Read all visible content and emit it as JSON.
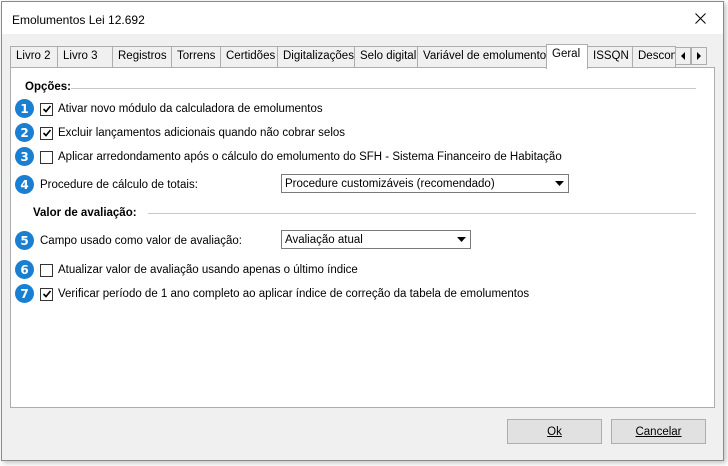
{
  "window": {
    "title": "Emolumentos Lei 12.692"
  },
  "tabs": [
    {
      "label": "Livro 2"
    },
    {
      "label": "Livro 3"
    },
    {
      "label": "Registros"
    },
    {
      "label": "Torrens"
    },
    {
      "label": "Certidões"
    },
    {
      "label": "Digitalizações"
    },
    {
      "label": "Selo digital"
    },
    {
      "label": "Variável de emolumentos"
    },
    {
      "label": "Geral",
      "active": true
    },
    {
      "label": "ISSQN"
    },
    {
      "label": "Descont"
    }
  ],
  "sections": {
    "options": "Opções:",
    "valuation": "Valor de avaliação:"
  },
  "options": [
    {
      "badge": "1",
      "label": "Ativar novo módulo da calculadora de emolumentos",
      "checked": true
    },
    {
      "badge": "2",
      "label": "Excluir lançamentos adicionais quando não cobrar selos",
      "checked": true
    },
    {
      "badge": "3",
      "label": "Aplicar arredondamento após o cálculo do emolumento do SFH - Sistema Financeiro de Habitação",
      "checked": false
    }
  ],
  "procedure": {
    "badge": "4",
    "label": "Procedure de cálculo de totais:",
    "value": "Procedure customizáveis (recomendado)"
  },
  "valuation_field": {
    "badge": "5",
    "label": "Campo usado como valor de avaliação:",
    "value": "Avaliação atual"
  },
  "valuation_options": [
    {
      "badge": "6",
      "label": "Atualizar valor de avaliação usando apenas o último índice",
      "checked": false
    },
    {
      "badge": "7",
      "label": "Verificar período de 1 ano completo ao aplicar índice de correção da tabela de emolumentos",
      "checked": true
    }
  ],
  "buttons": {
    "ok": "Ok",
    "cancel": "Cancelar"
  },
  "colors": {
    "badge": "#1a7fd1"
  },
  "icons": {
    "close": "close-icon",
    "check": "check-icon",
    "dropdown": "chevron-down-icon",
    "tab_left": "arrow-left-icon",
    "tab_right": "arrow-right-icon"
  }
}
